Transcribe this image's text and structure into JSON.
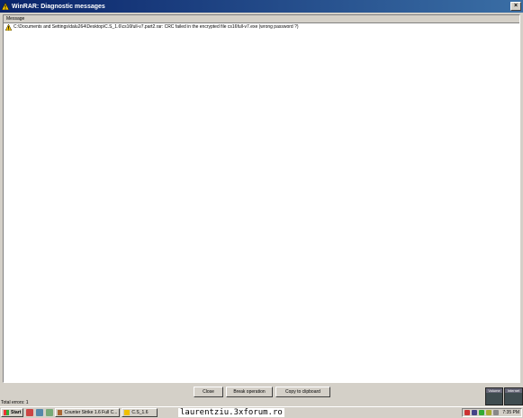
{
  "window": {
    "title": "WinRAR: Diagnostic messages",
    "close_glyph": "×"
  },
  "list": {
    "column_header": "Message",
    "rows": [
      {
        "icon": "warning-icon",
        "text": "C:\\Documents and Settings\\dalu264\\Desktop\\C.S_1.6\\cs16full-v7.part2.rar: CRC failed in the encrypted file cs16full-v7.exe (wrong password ?)"
      }
    ]
  },
  "buttons": {
    "close": "Close",
    "break": "Break operation",
    "copy": "Copy to clipboard"
  },
  "status": {
    "total_errors": "Total errors: 1"
  },
  "side_panels": {
    "left_label": "Volume",
    "right_label": "Internet"
  },
  "taskbar": {
    "start": "Start",
    "tasks": [
      {
        "label": "Counter Strike 1.6 Full C..."
      },
      {
        "label": "C.S_1.6"
      }
    ],
    "watermark": "laurentziu.3xforum.ro",
    "clock": "7:35 PM"
  },
  "colors": {
    "title_start": "#0a246a",
    "title_end": "#3a6ea5",
    "face": "#d4d0c8",
    "warning": "#f0c000"
  }
}
